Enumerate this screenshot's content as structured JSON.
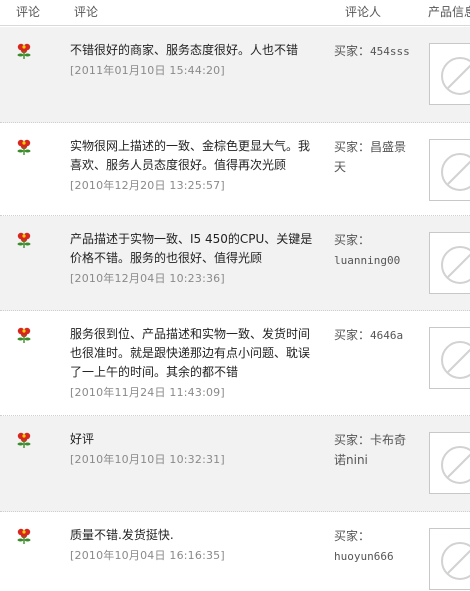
{
  "header": {
    "rating": "评论",
    "comment": "评论",
    "reviewer": "评论人",
    "product": "产品信息"
  },
  "reviews": [
    {
      "text": "不错很好的商家、服务态度很好。人也不错",
      "date": "[2011年01月10日 15:44:20]",
      "buyer_label": "买家：",
      "buyer_name": "454sss"
    },
    {
      "text": "实物很网上描述的一致、金棕色更显大气。我喜欢、服务人员态度很好。值得再次光顾",
      "date": "[2010年12月20日 13:25:57]",
      "buyer_label": "买家：",
      "buyer_name": "昌盛景天"
    },
    {
      "text": "产品描述于实物一致、I5 450的CPU、关键是价格不错。服务的也很好、值得光顾",
      "date": "[2010年12月04日 10:23:36]",
      "buyer_label": "买家：",
      "buyer_name": "luanning00"
    },
    {
      "text": "服务很到位、产品描述和实物一致、发货时间也很准时。就是跟快递那边有点小问题、耽误了一上午的时间。其余的都不错",
      "date": "[2010年11月24日 11:43:09]",
      "buyer_label": "买家：",
      "buyer_name": "4646a"
    },
    {
      "text": "好评",
      "date": "[2010年10月10日 10:32:31]",
      "buyer_label": "买家：",
      "buyer_name": "卡布奇诺nini"
    },
    {
      "text": "质量不错.发货挺快.",
      "date": "[2010年10月04日 16:16:35]",
      "buyer_label": "买家：",
      "buyer_name": "huoyun666"
    }
  ],
  "colors": {
    "flower_red": "#d7261e",
    "flower_green": "#3a8c2a",
    "alt_row": "#f2f2f2"
  }
}
